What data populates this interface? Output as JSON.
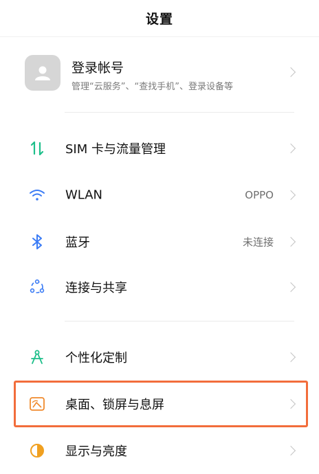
{
  "header": {
    "title": "设置"
  },
  "account": {
    "name": "登录帐号",
    "subtitle": "管理“云服务”、“查找手机”、登录设备等"
  },
  "rows": [
    {
      "label": "SIM 卡与流量管理",
      "value": "",
      "icon": "sim-data-icon",
      "color": "#1dbf8a"
    },
    {
      "label": "WLAN",
      "value": "OPPO",
      "icon": "wifi-icon",
      "color": "#3a7bf5"
    },
    {
      "label": "蓝牙",
      "value": "未连接",
      "icon": "bluetooth-icon",
      "color": "#3a7bf5"
    },
    {
      "label": "连接与共享",
      "value": "",
      "icon": "share-icon",
      "color": "#3a7bf5"
    },
    {
      "label": "个性化定制",
      "value": "",
      "icon": "compass-icon",
      "color": "#1dbf8a"
    },
    {
      "label": "桌面、锁屏与息屏",
      "value": "",
      "icon": "wallpaper-icon",
      "color": "#f08a2c"
    },
    {
      "label": "显示与亮度",
      "value": "",
      "icon": "brightness-icon",
      "color": "#f0a020"
    }
  ],
  "highlight_color": "#f26d3b"
}
